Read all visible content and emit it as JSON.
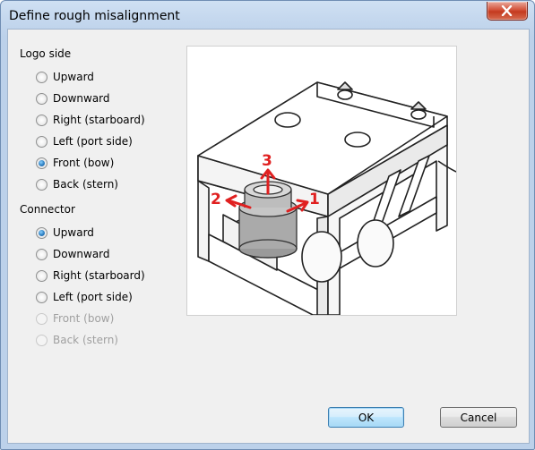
{
  "window": {
    "title": "Define rough misalignment"
  },
  "logo_side": {
    "label": "Logo side",
    "options": [
      {
        "label": "Upward",
        "checked": false,
        "enabled": true
      },
      {
        "label": "Downward",
        "checked": false,
        "enabled": true
      },
      {
        "label": "Right (starboard)",
        "checked": false,
        "enabled": true
      },
      {
        "label": "Left (port side)",
        "checked": false,
        "enabled": true
      },
      {
        "label": "Front (bow)",
        "checked": true,
        "enabled": true
      },
      {
        "label": "Back (stern)",
        "checked": false,
        "enabled": true
      }
    ]
  },
  "connector": {
    "label": "Connector",
    "options": [
      {
        "label": "Upward",
        "checked": true,
        "enabled": true
      },
      {
        "label": "Downward",
        "checked": false,
        "enabled": true
      },
      {
        "label": "Right (starboard)",
        "checked": false,
        "enabled": true
      },
      {
        "label": "Left (port side)",
        "checked": false,
        "enabled": true
      },
      {
        "label": "Front (bow)",
        "checked": false,
        "enabled": false
      },
      {
        "label": "Back (stern)",
        "checked": false,
        "enabled": false
      }
    ]
  },
  "illustration": {
    "arrow_labels": [
      "1",
      "2",
      "3"
    ],
    "arrow_color": "#e02020"
  },
  "buttons": {
    "ok": "OK",
    "cancel": "Cancel"
  }
}
